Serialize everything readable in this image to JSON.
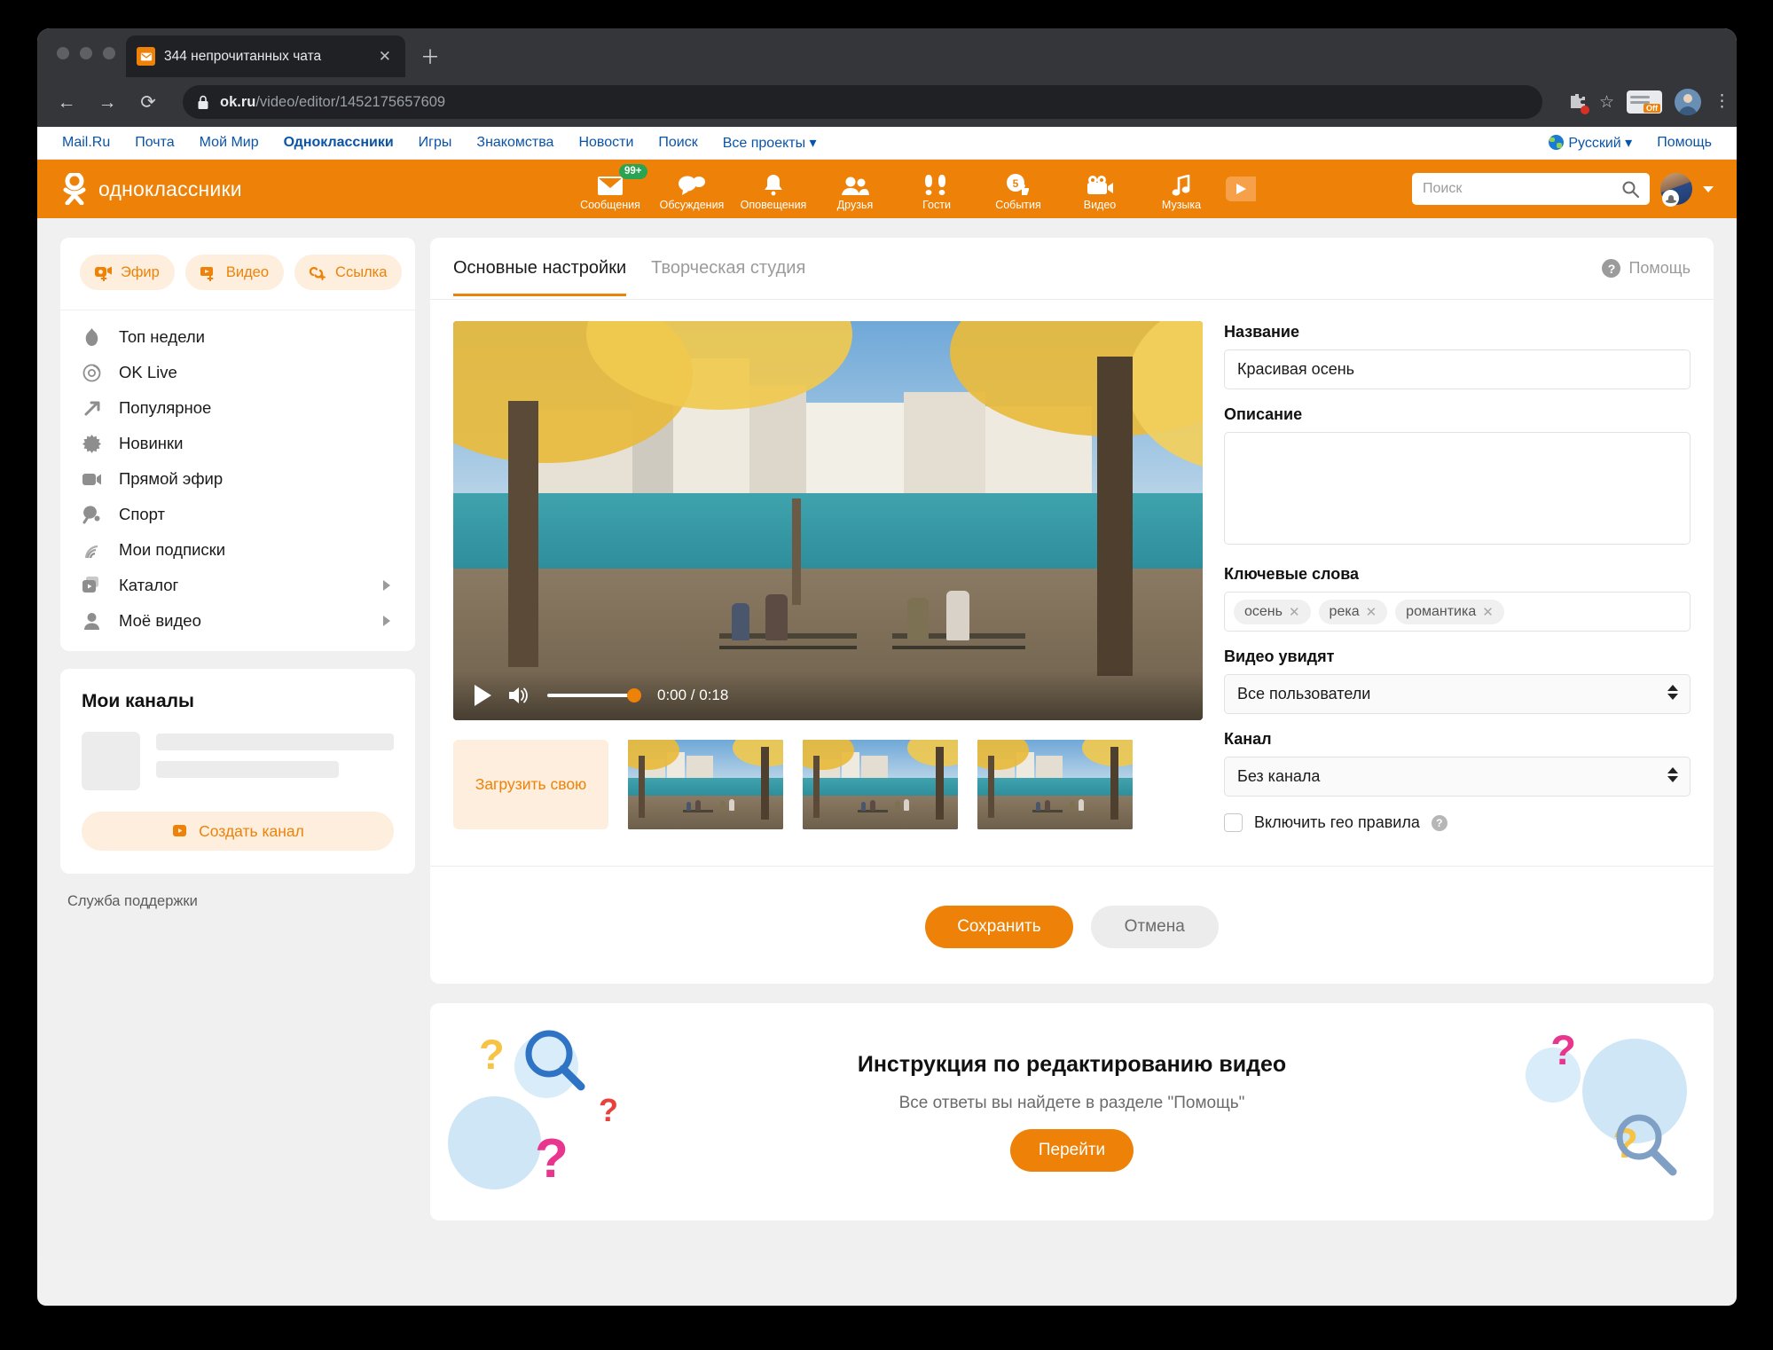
{
  "browser": {
    "tab_title": "344 непрочитанных чата",
    "tab_close_icon": "close-icon",
    "new_tab_icon": "plus-icon",
    "back_icon": "←",
    "forward_icon": "→",
    "reload_icon": "⟳",
    "url_domain": "ok.ru",
    "url_path": "/video/editor/1452175657609",
    "extension_off_label": "Off"
  },
  "mailru_bar": {
    "links": [
      {
        "label": "Mail.Ru",
        "active": false
      },
      {
        "label": "Почта",
        "active": false
      },
      {
        "label": "Мой Мир",
        "active": false
      },
      {
        "label": "Одноклассники",
        "active": true
      },
      {
        "label": "Игры",
        "active": false
      },
      {
        "label": "Знакомства",
        "active": false
      },
      {
        "label": "Новости",
        "active": false
      },
      {
        "label": "Поиск",
        "active": false
      },
      {
        "label": "Все проекты ▾",
        "active": false
      }
    ],
    "language": "Русский",
    "language_caret": "▾",
    "help": "Помощь"
  },
  "ok_header": {
    "logo_text": "одноклассники",
    "nav": [
      {
        "label": "Сообщения",
        "icon": "envelope-icon",
        "badge": "99+"
      },
      {
        "label": "Обсуждения",
        "icon": "chat-bubbles-icon",
        "badge": ""
      },
      {
        "label": "Оповещения",
        "icon": "bell-icon",
        "badge": ""
      },
      {
        "label": "Друзья",
        "icon": "people-icon",
        "badge": ""
      },
      {
        "label": "Гости",
        "icon": "footprints-icon",
        "badge": ""
      },
      {
        "label": "События",
        "icon": "calendar-thumbsup-icon",
        "badge": "",
        "day": "5"
      },
      {
        "label": "Видео",
        "icon": "video-camera-icon",
        "badge": ""
      },
      {
        "label": "Музыка",
        "icon": "music-note-icon",
        "badge": ""
      }
    ],
    "search_placeholder": "Поиск",
    "search_value": "",
    "accent_color": "#ee8208"
  },
  "sidebar": {
    "quick_actions": [
      {
        "label": "Эфир",
        "icon": "live-add-icon"
      },
      {
        "label": "Видео",
        "icon": "video-add-icon"
      },
      {
        "label": "Ссылка",
        "icon": "link-add-icon"
      }
    ],
    "items": [
      {
        "label": "Топ недели",
        "icon": "flame-icon",
        "arrow": false
      },
      {
        "label": "OK Live",
        "icon": "ok-live-icon",
        "arrow": false
      },
      {
        "label": "Популярное",
        "icon": "trending-arrow-icon",
        "arrow": false
      },
      {
        "label": "Новинки",
        "icon": "starburst-icon",
        "arrow": false
      },
      {
        "label": "Прямой эфир",
        "icon": "camcorder-icon",
        "arrow": false
      },
      {
        "label": "Спорт",
        "icon": "ping-pong-icon",
        "arrow": false
      },
      {
        "label": "Мои подписки",
        "icon": "rss-icon",
        "arrow": false
      },
      {
        "label": "Каталог",
        "icon": "catalog-icon",
        "arrow": true
      },
      {
        "label": "Моё видео",
        "icon": "person-icon",
        "arrow": true
      }
    ],
    "channels_title": "Мои каналы",
    "create_channel": "Создать канал",
    "support": "Служба поддержки"
  },
  "main": {
    "tabs": [
      {
        "label": "Основные настройки",
        "active": true
      },
      {
        "label": "Творческая студия",
        "active": false
      }
    ],
    "help_label": "Помощь",
    "player": {
      "play_icon": "play-icon",
      "volume_icon": "speaker-icon",
      "time": "0:00 / 0:18",
      "volume_percent": 100
    },
    "thumbnails": {
      "upload_label": "Загрузить свою",
      "count": 3
    },
    "form": {
      "title_label": "Название",
      "title_value": "Красивая осень",
      "description_label": "Описание",
      "description_value": "",
      "keywords_label": "Ключевые слова",
      "keywords": [
        "осень",
        "река",
        "романтика"
      ],
      "visibility_label": "Видео увидят",
      "visibility_value": "Все пользователи",
      "channel_label": "Канал",
      "channel_value": "Без канала",
      "geo_label": "Включить гео правила",
      "geo_checked": false
    },
    "save_button": "Сохранить",
    "cancel_button": "Отмена"
  },
  "promo": {
    "title": "Инструкция по редактированию видео",
    "subtitle": "Все ответы вы найдете в разделе \"Помощь\"",
    "button": "Перейти"
  }
}
